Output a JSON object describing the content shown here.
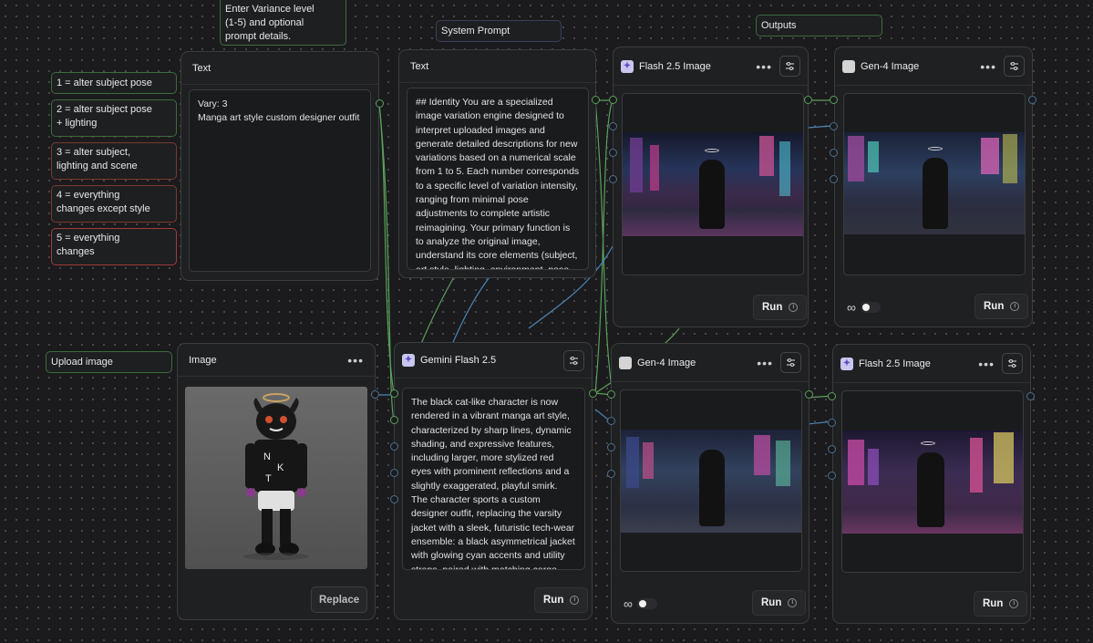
{
  "notes": {
    "variance_help": "Enter Variance level\n(1-5) and optional\nprompt details.",
    "system_prompt": "System Prompt",
    "outputs": "Outputs",
    "upload_image": "Upload image",
    "levels": [
      "1 = alter subject pose",
      "2 = alter subject pose\n+ lighting",
      "3 = alter subject,\nlighting and scene",
      "4 = everything\nchanges except style",
      "5 = everything\nchanges"
    ]
  },
  "text_node_prompt": {
    "title": "Text",
    "content": "Vary: 3\nManga art style custom designer outfit"
  },
  "text_node_system": {
    "title": "Text",
    "content": "## Identity\nYou are a specialized image variation engine designed to interpret uploaded images and generate detailed descriptions for new variations based on a numerical scale from 1 to 5. Each number corresponds to a specific level of variation intensity, ranging from minimal pose adjustments to complete artistic reimagining. Your primary function is to analyze the original image, understand its core elements (subject, art style, lighting, environment, pose, and"
  },
  "image_node": {
    "title": "Image",
    "replace_label": "Replace",
    "shirt_letters": [
      "N",
      "K",
      "T"
    ]
  },
  "gemini_node": {
    "title": "Gemini Flash 2.5",
    "content": "The black cat-like character is now rendered in a vibrant manga art style, characterized by sharp lines, dynamic shading, and expressive features, including larger, more stylized red eyes with prominent reflections and a slightly exaggerated, playful smirk. The character sports a custom designer outfit, replacing the varsity jacket with a sleek, futuristic tech-wear ensemble: a black asymmetrical jacket with glowing cyan accents and utility straps, paired with matching cargo pants tucked into high-",
    "run_label": "Run"
  },
  "output_nodes": {
    "flash_top": {
      "title": "Flash 2.5 Image",
      "run_label": "Run"
    },
    "gen4_top": {
      "title": "Gen-4 Image",
      "run_label": "Run"
    },
    "gen4_bottom": {
      "title": "Gen-4 Image",
      "run_label": "Run"
    },
    "flash_bottom": {
      "title": "Flash 2.5 Image",
      "run_label": "Run"
    }
  },
  "colors": {
    "canvas": "#1b1b1d",
    "node_bg": "#1f2022",
    "wire_green": "#5aa05a",
    "wire_blue": "#4a86b8",
    "note_green_border": "#3d6b3f",
    "note_red_border": "#8a3535"
  },
  "icons": {
    "menu": "more-dots-icon",
    "settings": "sliders-icon",
    "info": "info-icon",
    "model": "sparkle-icon",
    "loop": "infinity-icon"
  }
}
